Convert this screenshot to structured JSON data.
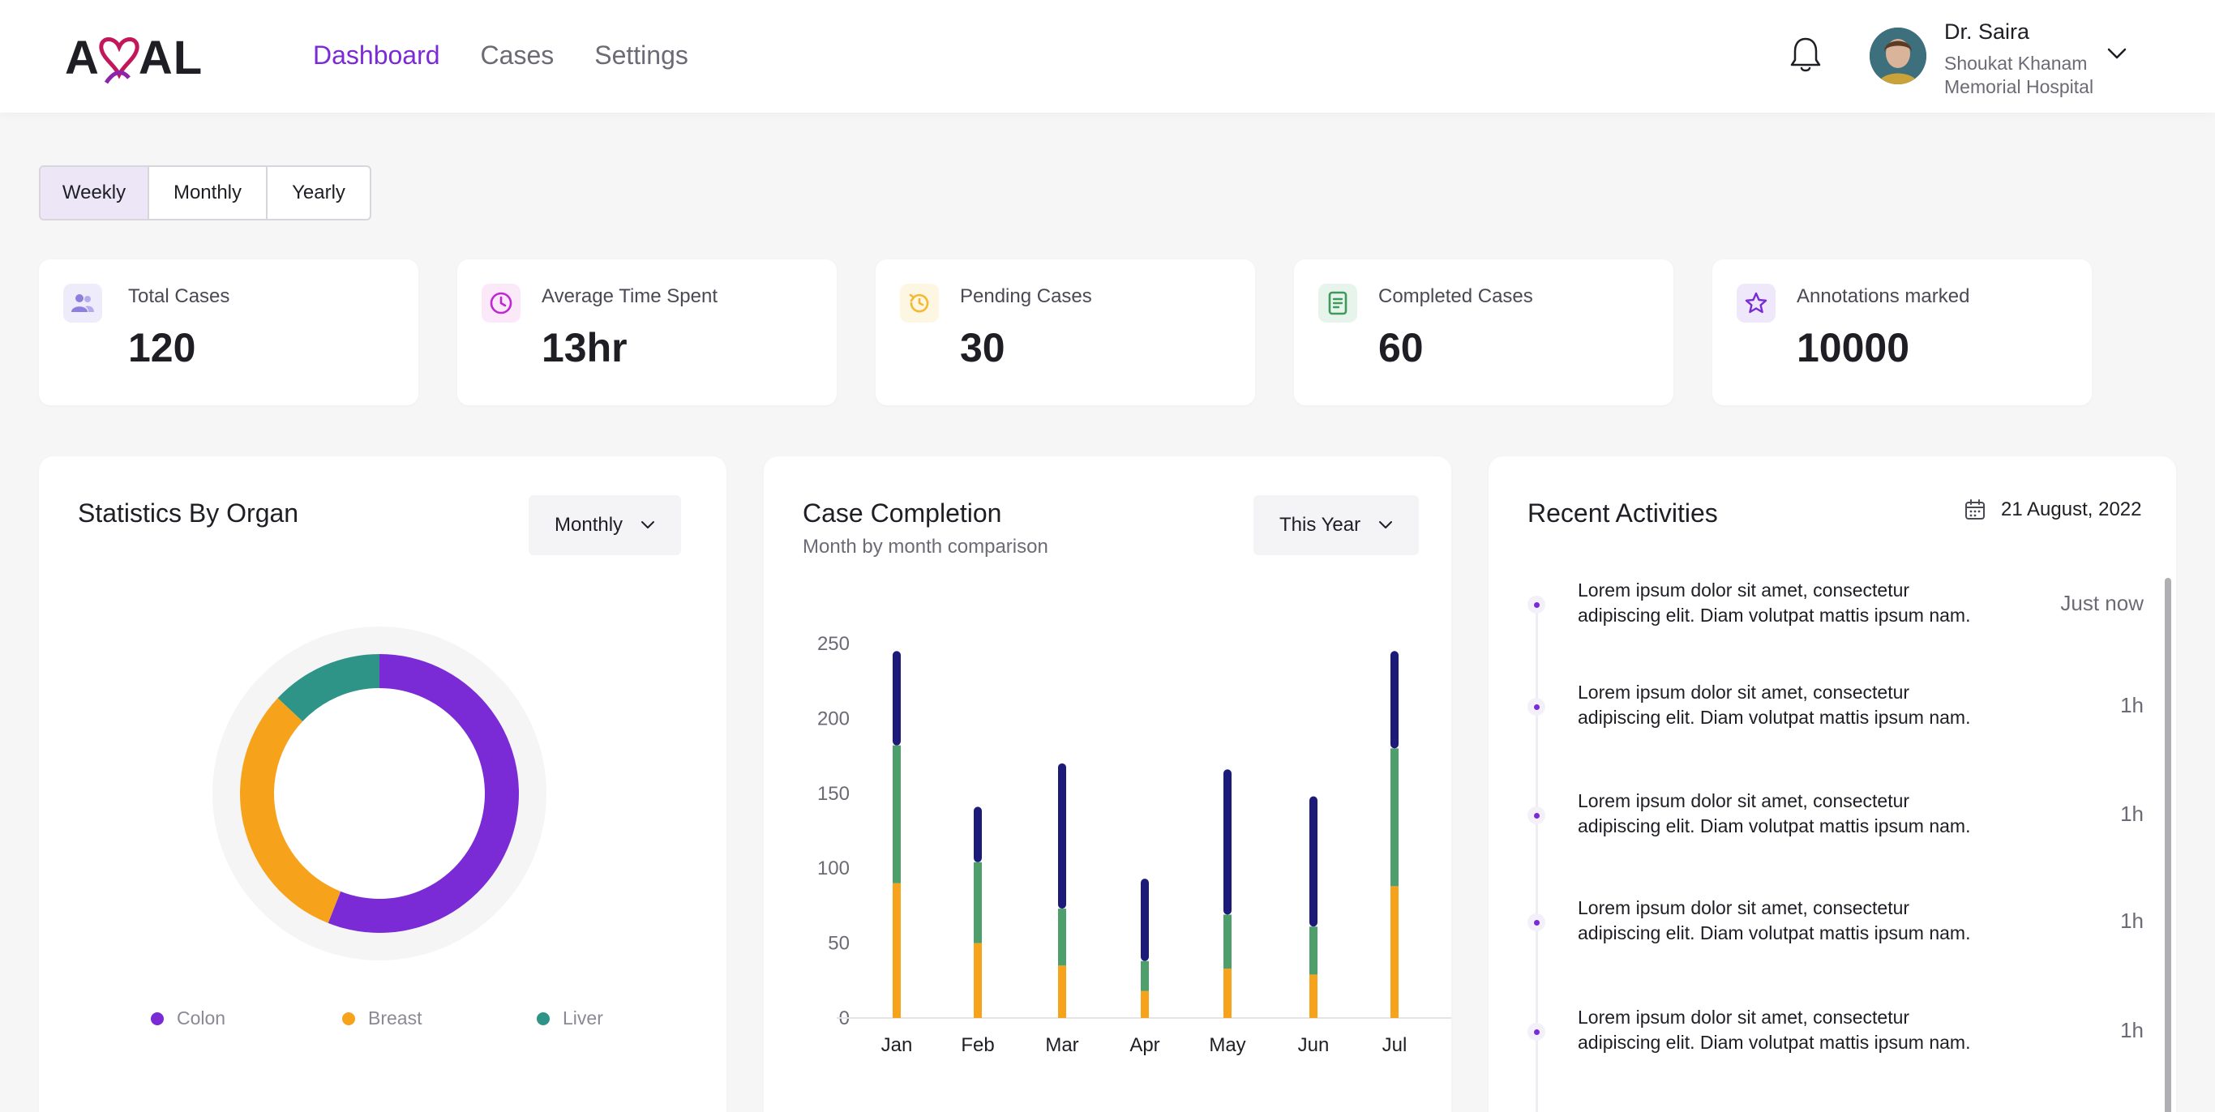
{
  "app": {
    "logo_left": "A",
    "logo_right": "AL",
    "nav": [
      {
        "label": "Dashboard",
        "active": true
      },
      {
        "label": "Cases",
        "active": false
      },
      {
        "label": "Settings",
        "active": false
      }
    ],
    "user": {
      "name": "Dr. Saira",
      "org_line1": "Shoukat Khanam",
      "org_line2": "Memorial Hospital"
    }
  },
  "period_toggle": {
    "options": [
      "Weekly",
      "Monthly",
      "Yearly"
    ],
    "selected": "Weekly"
  },
  "stats": [
    {
      "label": "Total Cases",
      "value": "120",
      "icon": "users-icon",
      "color": "#8b7fe0"
    },
    {
      "label": "Average Time Spent",
      "value": "13hr",
      "icon": "clock-icon",
      "color": "#c026d3"
    },
    {
      "label": "Pending Cases",
      "value": "30",
      "icon": "history-icon",
      "color": "#f5b82e"
    },
    {
      "label": "Completed Cases",
      "value": "60",
      "icon": "document-icon",
      "color": "#3e9a5a"
    },
    {
      "label": "Annotations marked",
      "value": "10000",
      "icon": "star-icon",
      "color": "#7a2bd6"
    }
  ],
  "organ_stats": {
    "title": "Statistics By Organ",
    "period": "Monthly"
  },
  "case_completion": {
    "title": "Case Completion",
    "subtitle": "Month by month comparison",
    "period": "This Year"
  },
  "recent_activities": {
    "title": "Recent Activities",
    "date": "21 August, 2022",
    "items": [
      {
        "line1": "Lorem ipsum dolor sit amet, consectetur",
        "line2": "adipiscing elit. Diam volutpat mattis ipsum nam.",
        "time": "Just now"
      },
      {
        "line1": "Lorem ipsum dolor sit amet, consectetur",
        "line2": "adipiscing elit. Diam volutpat mattis ipsum nam.",
        "time": "1h"
      },
      {
        "line1": "Lorem ipsum dolor sit amet, consectetur",
        "line2": "adipiscing elit. Diam volutpat mattis ipsum nam.",
        "time": "1h"
      },
      {
        "line1": "Lorem ipsum dolor sit amet, consectetur",
        "line2": "adipiscing elit. Diam volutpat mattis ipsum nam.",
        "time": "1h"
      },
      {
        "line1": "Lorem ipsum dolor sit amet, consectetur",
        "line2": "adipiscing elit. Diam volutpat mattis ipsum nam.",
        "time": "1h"
      }
    ]
  },
  "colors": {
    "accent": "#7a2bd6",
    "colon": "#7a2bd6",
    "breast": "#f7a21b",
    "liver": "#2e9487",
    "bar_top": "#1c1b7a",
    "bar_mid": "#4e9f6c",
    "bar_bottom": "#f7a21b"
  },
  "chart_data": [
    {
      "type": "pie",
      "categories": [
        "Colon",
        "Breast",
        "Liver"
      ],
      "values": [
        56,
        31,
        13
      ],
      "legend": "bottom"
    },
    {
      "type": "bar",
      "stacked": true,
      "categories": [
        "Jan",
        "Feb",
        "Mar",
        "Apr",
        "May",
        "Jun",
        "Jul"
      ],
      "series": [
        {
          "values": [
            90,
            50,
            35,
            18,
            33,
            29,
            88
          ]
        },
        {
          "values": [
            92,
            54,
            38,
            20,
            36,
            32,
            92
          ]
        },
        {
          "values": [
            63,
            37,
            97,
            55,
            97,
            87,
            65
          ]
        }
      ],
      "yticks": [
        0,
        50,
        100,
        150,
        200,
        250
      ],
      "ylim": [
        0,
        250
      ],
      "grid": false
    }
  ]
}
